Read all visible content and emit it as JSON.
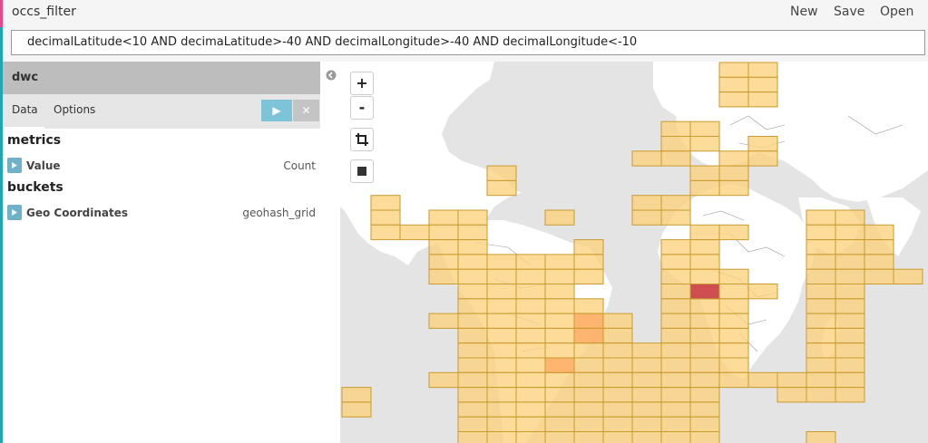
{
  "app": {
    "title": "occs_filter",
    "actions": {
      "new": "New",
      "save": "Save",
      "open": "Open"
    }
  },
  "query": {
    "value": "decimalLatitude<10 AND decimaLatitude>-40 AND decimalLongitude>-40 AND decimalLongitude<-10"
  },
  "sidebar": {
    "index_name": "dwc",
    "tabs": {
      "data": "Data",
      "options": "Options"
    },
    "apply_symbol": "▶",
    "discard_symbol": "✕",
    "metrics_title": "metrics",
    "metric": {
      "label": "Value",
      "type": "Count"
    },
    "buckets_title": "buckets",
    "bucket": {
      "label": "Geo Coordinates",
      "type": "geohash_grid"
    }
  },
  "map": {
    "zoom_in": "+",
    "zoom_out": "-",
    "icons": [
      "plus-icon",
      "minus-icon",
      "crop-icon",
      "stop-icon"
    ],
    "colors": {
      "low": "#fdd27e",
      "medium": "#fcaa63",
      "high": "#c0263e",
      "land": "#ffffff",
      "water": "#e4e4e4"
    }
  }
}
